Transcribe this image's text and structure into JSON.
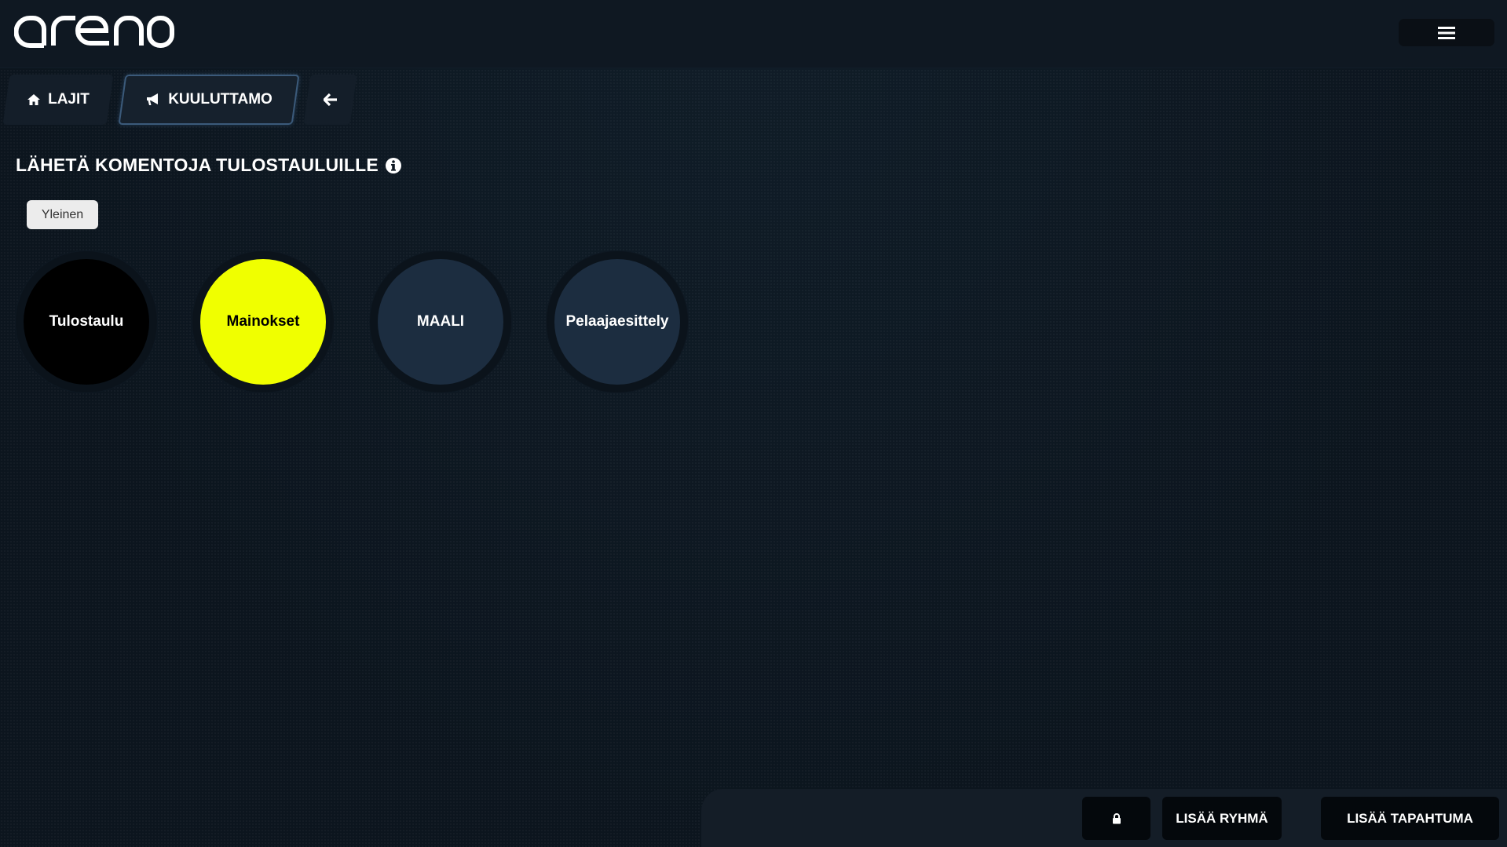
{
  "header": {
    "logo_text": "areno",
    "menu_icon": "hamburger-menu-icon"
  },
  "nav": {
    "tabs": [
      {
        "label": "LAJIT",
        "icon": "home-icon"
      },
      {
        "label": "KUULUTTAMO",
        "icon": "megaphone-icon",
        "active": true
      },
      {
        "label": "",
        "icon": "arrow-left-icon"
      }
    ]
  },
  "main": {
    "title": "LÄHETÄ KOMENTOJA TULOSTAULUILLE",
    "title_icon": "info-icon",
    "groups": [
      {
        "label": "Yleinen"
      }
    ],
    "commands": [
      {
        "label": "Tulostaulu",
        "color": "#000000",
        "text_color": "#ffffff"
      },
      {
        "label": "Mainokset",
        "color": "#f0ff00",
        "text_color": "#000000"
      },
      {
        "label": "MAALI",
        "color": "#1c2d40",
        "text_color": "#ffffff"
      },
      {
        "label": "Pelaajaesittely",
        "color": "#1c2d40",
        "text_color": "#ffffff"
      }
    ]
  },
  "footer": {
    "lock_icon": "lock-icon",
    "add_group_label": "LISÄÄ RYHMÄ",
    "add_event_label": "LISÄÄ TAPAHTUMA"
  }
}
